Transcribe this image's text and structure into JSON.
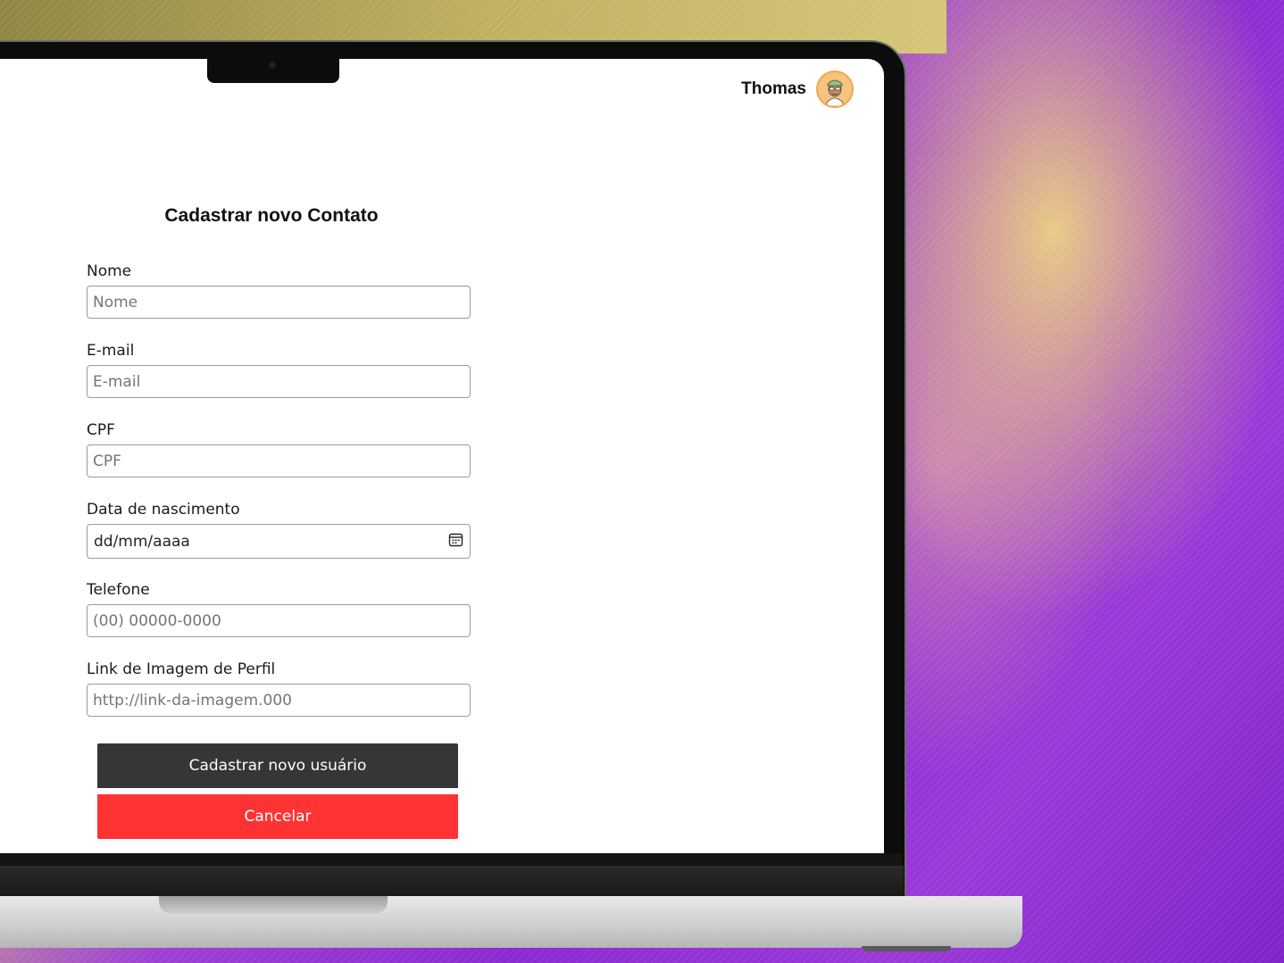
{
  "header": {
    "user_name": "Thomas"
  },
  "form": {
    "title": "Cadastrar novo Contato",
    "fields": {
      "nome": {
        "label": "Nome",
        "placeholder": "Nome",
        "value": ""
      },
      "email": {
        "label": "E-mail",
        "placeholder": "E-mail",
        "value": ""
      },
      "cpf": {
        "label": "CPF",
        "placeholder": "CPF",
        "value": ""
      },
      "nascimento": {
        "label": "Data de nascimento",
        "display": "dd/mm/aaaa"
      },
      "telefone": {
        "label": "Telefone",
        "placeholder": "(00) 00000-0000",
        "value": ""
      },
      "imagem": {
        "label": "Link de Imagem de Perfil",
        "placeholder": "http://link-da-imagem.000",
        "value": ""
      }
    },
    "submit_label": "Cadastrar novo usuário",
    "cancel_label": "Cancelar"
  },
  "icons": {
    "calendar": "calendar-icon",
    "avatar": "avatar-illustration"
  },
  "colors": {
    "primary_button": "#353638",
    "cancel_button": "#ff3333"
  }
}
